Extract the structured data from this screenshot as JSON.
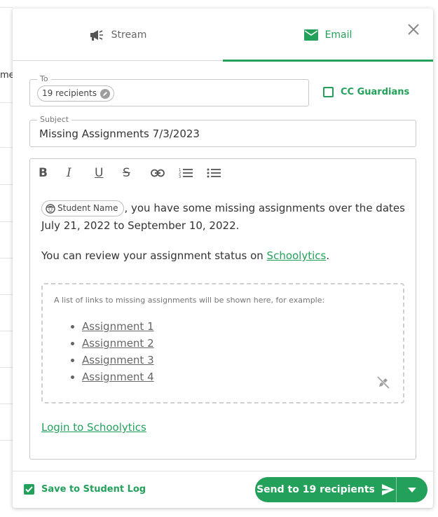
{
  "background": {
    "partial_text": "me"
  },
  "tabs": [
    {
      "label": "Stream",
      "icon": "megaphone-icon",
      "active": false
    },
    {
      "label": "Email",
      "icon": "mail-icon",
      "active": true
    }
  ],
  "to": {
    "label": "To",
    "chip": "19 recipients"
  },
  "cc_guardians": {
    "label": "CC Guardians",
    "checked": false
  },
  "subject": {
    "label": "Subject",
    "value": "Missing Assignments 7/3/2023"
  },
  "editor": {
    "toolbar": [
      "bold",
      "italic",
      "underline",
      "strikethrough",
      "link",
      "numbered-list",
      "bulleted-list"
    ],
    "toolbar_glyphs": {
      "bold": "B",
      "italic": "I",
      "underline": "U",
      "strike": "S"
    },
    "student_chip": "Student Name",
    "line1_rest": ", you have some missing assignments over the dates July 21, 2022 to September 10, 2022.",
    "line2_prefix": "You can review your assignment status on ",
    "line2_link": "Schoolytics",
    "line2_suffix": ".",
    "placeholder_caption": "A list of links to missing assignments will be shown here, for example:",
    "assignments": [
      "Assignment 1",
      "Assignment 2",
      "Assignment 3",
      "Assignment 4"
    ],
    "login_link": "Login to Schoolytics"
  },
  "footer": {
    "save_log_label": "Save to Student Log",
    "save_log_checked": true,
    "send_label": "Send to 19 recipients"
  },
  "colors": {
    "accent": "#23a15b",
    "border": "#c8c8c8",
    "text": "#333333"
  }
}
